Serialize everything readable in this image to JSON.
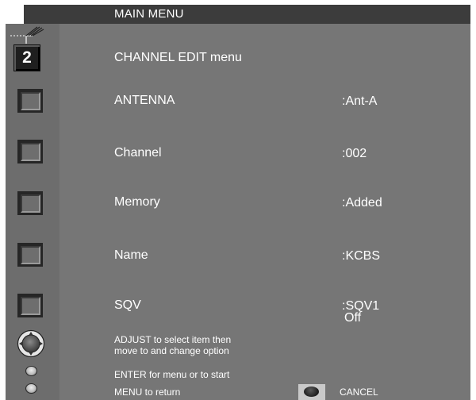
{
  "header": {
    "title": "MAIN MENU"
  },
  "channel_indicator": {
    "number": "2",
    "icon": "antenna-icon"
  },
  "menu": {
    "heading": "CHANNEL EDIT menu",
    "items": [
      {
        "label": "ANTENNA",
        "value": ":Ant-A"
      },
      {
        "label": "Channel",
        "value": ":002"
      },
      {
        "label": "Memory",
        "value": ":Added"
      },
      {
        "label": "Name",
        "value": ":KCBS"
      },
      {
        "label": "SQV",
        "value": ":SQV1",
        "value2": "Off"
      }
    ]
  },
  "hints": {
    "adjust_line1": "ADJUST to select item then",
    "adjust_line2": "move to and change option",
    "enter": "ENTER for menu or to start",
    "menu_return": "MENU to return",
    "cancel": "CANCEL"
  },
  "colors": {
    "background": "#767676",
    "left_column": "#6d6d6d",
    "header_bar": "#3c3c3c",
    "text": "#ffffff"
  }
}
